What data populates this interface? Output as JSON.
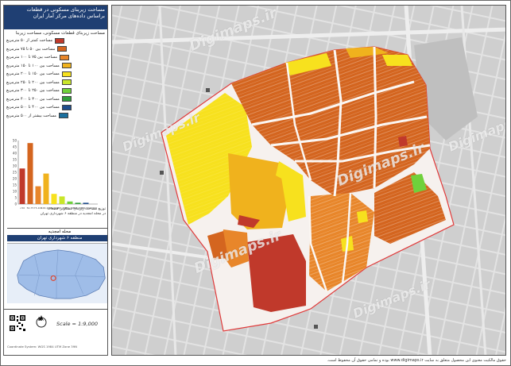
{
  "panel": {
    "title_line1": "مساحت زیربنای مسکونی در قطعات",
    "title_line2": "براساس داده‌های مرکز آمار ایران",
    "subtitle": "مساحت زیربنای قطعات مسکونی، مساحت زیربنا",
    "legend": [
      {
        "label": "مساحت کمتر از ۵۰ مترمربع",
        "color": "#c0392b"
      },
      {
        "label": "مساحت بین ۵۰ تا ۷۵ مترمربع",
        "color": "#d4651f"
      },
      {
        "label": "مساحت بین ۷۵ تا ۱۰۰ مترمربع",
        "color": "#e8862a"
      },
      {
        "label": "مساحت بین ۱۰۰ تا ۱۵۰ مترمربع",
        "color": "#f0b21d"
      },
      {
        "label": "مساحت بین ۱۵۰ تا ۲۰۰ مترمربع",
        "color": "#f7e11e"
      },
      {
        "label": "مساحت بین ۲۰۰ تا ۲۵۰ مترمربع",
        "color": "#c9e62a"
      },
      {
        "label": "مساحت بین ۲۵۰ تا ۳۰۰ مترمربع",
        "color": "#6fd13b"
      },
      {
        "label": "مساحت بین ۳۰۰ تا ۴۰۰ مترمربع",
        "color": "#2f9e3a"
      },
      {
        "label": "مساحت بین ۴۰۰ تا ۵۰۰ مترمربع",
        "color": "#1f4d8c"
      },
      {
        "label": "مساحت بیشتر از ۵۰۰ مترمربع",
        "color": "#1a6f9e"
      }
    ],
    "histogram_caption_line1": "توزیع مساحت زیربنای مسکونی قطعات",
    "histogram_caption_line2": "در محله امجدیه در منطقه ۶ شهرداری تهران",
    "neighbourhood": "محله امجدیه",
    "district": "منطقه ۶ شهرداری تهران",
    "scale": "Scale = 1:9,000",
    "north": "N",
    "small_note": "Coordinate System: WGS 1984 UTM Zone 39N"
  },
  "chart_data": {
    "type": "bar",
    "categories": [
      "<50",
      "50-75",
      "75-100",
      "100-150",
      "150-200",
      "200-250",
      "250-300",
      "300-400",
      "400-500",
      ">500"
    ],
    "values": [
      28,
      48,
      14,
      24,
      8,
      6,
      2,
      1,
      1,
      0
    ],
    "colors": [
      "#c0392b",
      "#d4651f",
      "#e8862a",
      "#f0b21d",
      "#f7e11e",
      "#c9e62a",
      "#6fd13b",
      "#2f9e3a",
      "#1f4d8c",
      "#1a6f9e"
    ],
    "ylim": [
      0,
      50
    ],
    "yticks": [
      0,
      5,
      10,
      15,
      20,
      25,
      30,
      35,
      40,
      45,
      50
    ],
    "grid": false
  },
  "map": {
    "watermark": "Digimaps.ir",
    "footer": "حقوق مالکیت معنوی این محصول متعلق به سایت www.digimaps.ir بوده و تمامی حقوق آن محفوظ است."
  }
}
